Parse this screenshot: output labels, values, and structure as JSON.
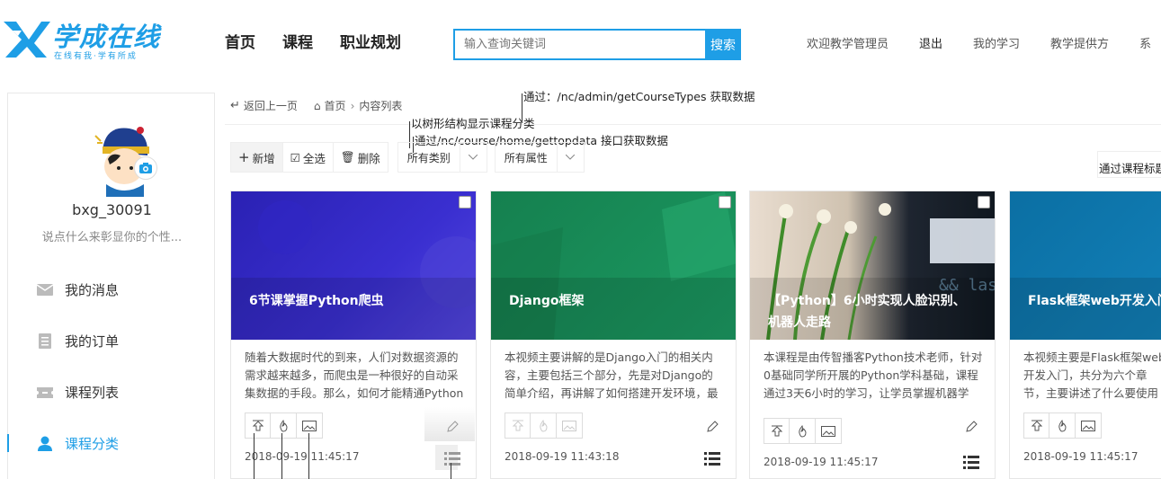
{
  "header": {
    "logo_text": "学成在线",
    "logo_slogan": "在线有我·学有所成",
    "nav": [
      "首页",
      "课程",
      "职业规划"
    ],
    "search_placeholder": "输入查询关键词",
    "search_button": "搜索",
    "user_links": {
      "welcome": "欢迎教学管理员",
      "logout": "退出",
      "my_study": "我的学习",
      "provider": "教学提供方",
      "more": "系"
    }
  },
  "sidebar": {
    "username": "bxg_30091",
    "signature": "说点什么来彰显你的个性...",
    "items": [
      {
        "label": "我的消息",
        "icon": "mail-icon"
      },
      {
        "label": "我的订单",
        "icon": "document-icon"
      },
      {
        "label": "课程列表",
        "icon": "ticket-icon"
      },
      {
        "label": "课程分类",
        "icon": "user-icon",
        "active": true
      }
    ]
  },
  "breadcrumb": {
    "back": "返回上一页",
    "home": "首页",
    "current": "内容列表"
  },
  "annotations": {
    "a1": "通过：/nc/admin/getCourseTypes 获取数据",
    "a2": "以树形结构显示课程分类",
    "a3": "通过/nc/course/home/gettopdata 接口获取数据",
    "a4": "通过课程标题"
  },
  "toolbar": {
    "add": "新增",
    "select_all": "全选",
    "delete": "删除",
    "category_select": "所有类别",
    "attribute_select": "所有属性"
  },
  "cards": [
    {
      "title": "6节课掌握Python爬虫",
      "desc": "随着大数据时代的到来，人们对数据资源的需求越来越多，而爬虫是一种很好的自动采集数据的手段。那么，如何才能精通Python网络",
      "date": "2018-09-19 11:45:17"
    },
    {
      "title": "Django框架",
      "desc": "本视频主要讲解的是Django入门的相关内容，主要包括三个部分，先是对Django的简单介绍，再讲解了如何搭建开发环境，最后讲",
      "date": "2018-09-19 11:43:18"
    },
    {
      "title": "【Python】6小时实现人脸识别、机器人走路",
      "desc": "本课程是由传智播客Python技术老师，针对0基础同学所开展的Python学科基础，课程通过3天6小时的学习，让学员掌握机器学习、",
      "date": "2018-09-19 11:45:17"
    },
    {
      "title": "Flask框架web开发入门",
      "desc": "本视频主要是Flask框架web开发入门，共分为六个章节，主要讲述了什么要使用WEB框架，Flask",
      "date": "2018-09-19 11:45:17"
    }
  ],
  "colors": {
    "accent": "#1e9ee6",
    "card1": "#2b23b8",
    "card2": "#1a8a5a",
    "card4": "#0e6fa0"
  }
}
